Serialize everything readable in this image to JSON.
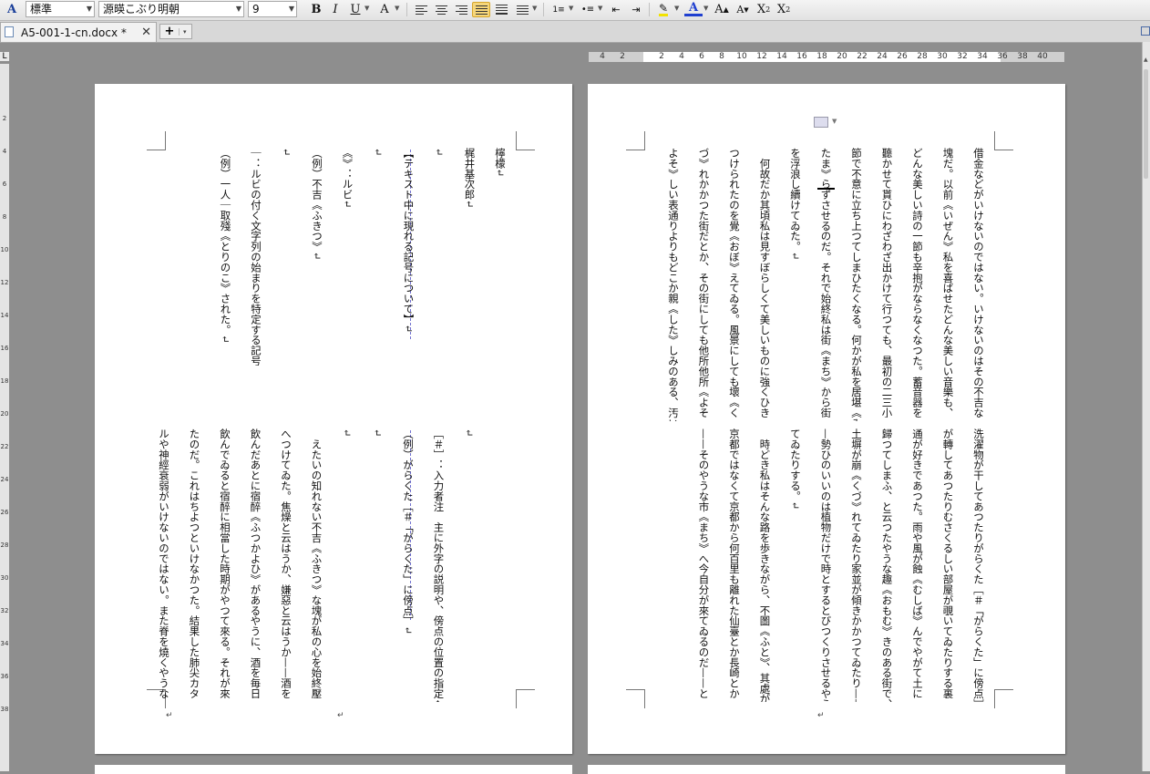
{
  "toolbar": {
    "paragraph_style": "標準",
    "font_name": "源暎こぶり明朝",
    "font_size": "9",
    "bold": "B",
    "italic": "I",
    "underline": "U",
    "char_shading": "A",
    "font_color": "A",
    "grow_font": "A",
    "shrink_font": "A",
    "superscript": "X",
    "superscript_mark": "2",
    "subscript": "X",
    "subscript_mark": "2",
    "highlight_color": "#f2e200",
    "font_color_value": "#1f3fd0"
  },
  "tabs": {
    "document": "A5-001-1-cn.docx *",
    "close": "✕",
    "new": "+",
    "new_dropdown": "▾"
  },
  "ruler": {
    "corner": "L",
    "horizontal_marks": [
      "4",
      "2",
      "2",
      "4",
      "6",
      "8",
      "10",
      "12",
      "14",
      "16",
      "18",
      "20",
      "22",
      "24",
      "26",
      "28",
      "30",
      "32",
      "34",
      "36",
      "38",
      "40"
    ],
    "vertical_marks": [
      "2",
      "4",
      "6",
      "8",
      "10",
      "12",
      "14",
      "16",
      "18",
      "20",
      "22",
      "24",
      "26",
      "28",
      "30",
      "32",
      "34",
      "36",
      "38"
    ]
  },
  "pages": {
    "left": {
      "columns_top": [
        "檸檬↵",
        "梶井基次郎↵",
        "↵",
        "【テキスト中に現れる記号について】↵",
        "↵",
        "《》：ルビ↵",
        "（例）不吉《ふきつ》↵",
        "↵",
        "｜：ルビの付く文字列の始まりを特定する記号",
        "（例）一人｜取殘《とりのこ》された。↵"
      ],
      "columns_bottom": [
        "↵",
        "［＃］：入力者注　主に外字の説明や、傍点の位置の指定↵",
        "（例）がらくた［＃「がらくた」に傍点］↵",
        "↵",
        "↵",
        "　えたいの知れない不吉《ふきつ》な塊が私の心を始終壓",
        "へつけてゐた。焦燥と云はうか、嫌惡と云はうか——酒を",
        "飲んだあとに宿醉《ふつかよひ》があるやうに、酒を毎日",
        "飲んでゐると宿醉に相當した時期がやつて來る。それが來",
        "たのだ。これはちよつといけなかつた。結果した肺尖カタ",
        "ルや神經衰弱がいけないのではない。また脊を燒くやうな"
      ]
    },
    "right": {
      "columns_top": [
        "借金などがいけないのではない。いけないのはその不吉な",
        "塊だ。以前《いぜん》私を喜ばせたどんな美しい音樂も、",
        "どんな美しい詩の一節も辛抱がならなくなつた。蓄音器を",
        "聽かせて貰ひにわざわざ出かけて行つても、最初の二三小",
        "節で不意に立ち上つてしまひたくなる。何かが私を居堪《ゐ",
        "たま》らずさせるのだ。それで始終私は街《まち》から街",
        "を浮浪し續けてゐた。↵",
        "　何故だか其頃私は見すぼらしくて美しいものに強くひき",
        "つけられたのを覺《おぼ》えてゐる。風景にしても壞《く",
        "づ》れかかつた街だとか、その街にしても他所他所《よそ",
        "よそ》しい表通りよりもどこか親《した》しみのある、汚い"
      ],
      "columns_bottom": [
        "洗濯物が干してあつたりがらくた［＃「がらくた」に傍点］",
        "が轉してあつたりむさくるしい部屋が覗いてゐたりする裏",
        "通が好きであつた。雨や風が蝕《むしば》んでやがて土に",
        "歸つてしまふ、と云つたやうな趣《おもむ》きのある街で、",
        "土塀が崩《くづ》れてゐたり家並が傾きかかつてゐたり——",
        "—勢ひのいいのは植物だけで時とするとびつくりさせるやうな向日葵《ひまはり》があつたりカンナが咲い",
        "てゐたりする。↵",
        "　時どき私はそんな路を歩きながら、不圖《ふと》、其處が",
        "京都ではなくて京都から何百里も離れた仙臺とか長崎とか",
        "——そのやうな市《まち》へ今自分が來てゐるのだ——と"
      ]
    }
  }
}
